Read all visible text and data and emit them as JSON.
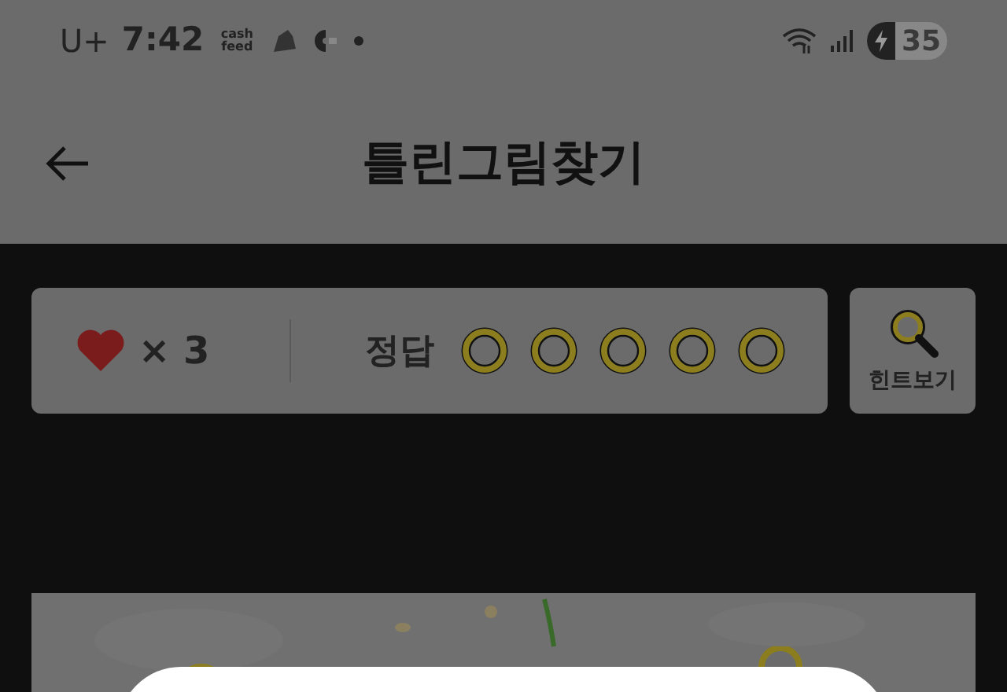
{
  "status_bar": {
    "carrier": "U+",
    "time": "7:42",
    "app_logo_text": "cash feed",
    "battery": "35",
    "charging": true
  },
  "header": {
    "title": "틀린그림찾기"
  },
  "score": {
    "lives": "× 3",
    "answer_label": "정답",
    "answers": [
      {
        "found": false
      },
      {
        "found": false
      },
      {
        "found": false
      },
      {
        "found": false
      },
      {
        "found": false
      }
    ]
  },
  "hint_button": {
    "label": "힌트보기"
  }
}
